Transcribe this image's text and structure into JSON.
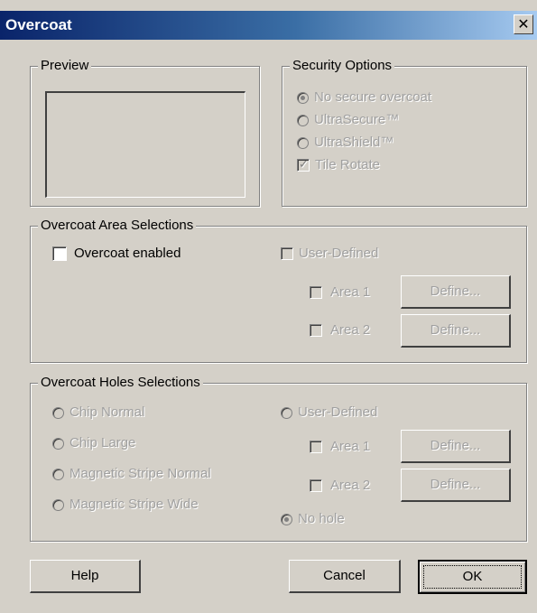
{
  "window": {
    "title": "Overcoat",
    "close_glyph": "✕"
  },
  "preview": {
    "legend": "Preview"
  },
  "security": {
    "legend": "Security Options",
    "options": [
      {
        "label": "No secure overcoat",
        "type": "radio",
        "selected": true,
        "enabled": false
      },
      {
        "label": "UltraSecure™",
        "type": "radio",
        "selected": false,
        "enabled": false
      },
      {
        "label": "UltraShield™",
        "type": "radio",
        "selected": false,
        "enabled": false
      },
      {
        "label": "Tile Rotate",
        "type": "checkbox",
        "checked": true,
        "enabled": false
      }
    ]
  },
  "area": {
    "legend": "Overcoat Area Selections",
    "overcoat_enabled": {
      "label": "Overcoat enabled",
      "checked": false,
      "enabled": true
    },
    "user_defined": {
      "label": "User-Defined",
      "checked": false,
      "enabled": false
    },
    "area1": {
      "label": "Area 1",
      "checked": false,
      "button": "Define..."
    },
    "area2": {
      "label": "Area 2",
      "checked": false,
      "button": "Define..."
    }
  },
  "holes": {
    "legend": "Overcoat Holes Selections",
    "left_options": [
      "Chip Normal",
      "Chip Large",
      "Magnetic Stripe Normal",
      "Magnetic Stripe Wide"
    ],
    "user_defined": {
      "label": "User-Defined",
      "selected": false
    },
    "area1": {
      "label": "Area 1",
      "checked": false,
      "button": "Define..."
    },
    "area2": {
      "label": "Area 2",
      "checked": false,
      "button": "Define..."
    },
    "no_hole": {
      "label": "No hole",
      "selected": true
    }
  },
  "buttons": {
    "help": "Help",
    "cancel": "Cancel",
    "ok": "OK"
  }
}
